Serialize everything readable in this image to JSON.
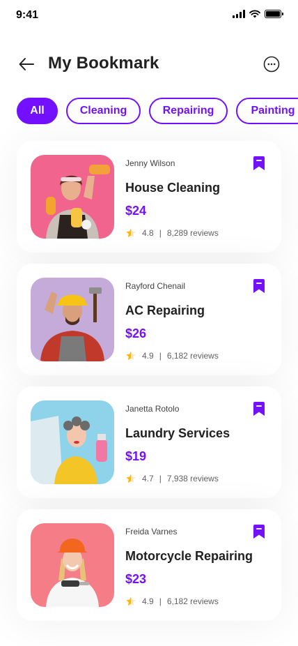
{
  "status_bar": {
    "time": "9:41"
  },
  "header": {
    "title": "My Bookmark"
  },
  "filters": [
    "All",
    "Cleaning",
    "Repairing",
    "Painting"
  ],
  "colors": {
    "accent": "#7210FF",
    "star": "#FFB300"
  },
  "bookmarks": [
    {
      "provider": "Jenny Wilson",
      "service": "House Cleaning",
      "price": "$24",
      "rating": "4.8",
      "reviews": "8,289 reviews"
    },
    {
      "provider": "Rayford Chenail",
      "service": "AC Repairing",
      "price": "$26",
      "rating": "4.9",
      "reviews": "6,182 reviews"
    },
    {
      "provider": "Janetta Rotolo",
      "service": "Laundry Services",
      "price": "$19",
      "rating": "4.7",
      "reviews": "7,938 reviews"
    },
    {
      "provider": "Freida Varnes",
      "service": "Motorcycle Repairing",
      "price": "$23",
      "rating": "4.9",
      "reviews": "6,182 reviews"
    }
  ]
}
